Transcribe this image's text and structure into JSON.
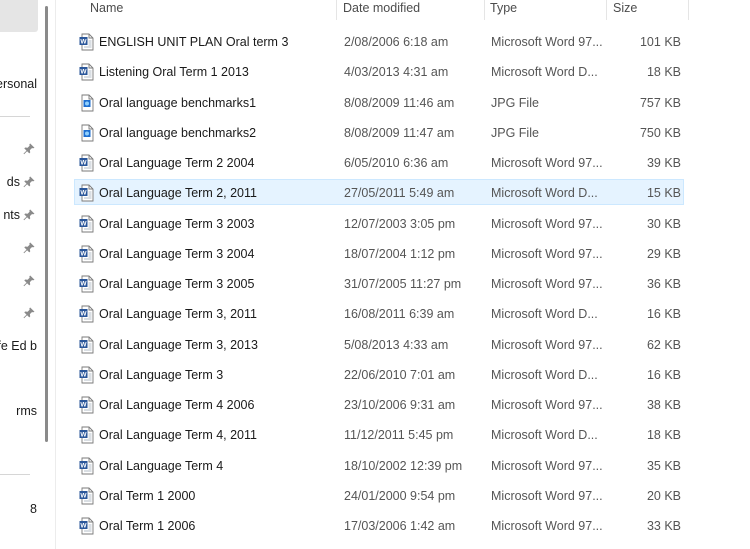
{
  "nav": {
    "items": [
      {
        "label": "ersonal",
        "pinned": false
      },
      {
        "label": "",
        "pinned": true
      },
      {
        "label": "ds",
        "pinned": true
      },
      {
        "label": "nts",
        "pinned": true
      },
      {
        "label": "",
        "pinned": true
      },
      {
        "label": "",
        "pinned": true
      },
      {
        "label": "",
        "pinned": true
      },
      {
        "label": "ife Ed b",
        "pinned": false
      },
      {
        "label": "rms",
        "pinned": false
      },
      {
        "label": "8",
        "pinned": false
      }
    ]
  },
  "columns": {
    "name": "Name",
    "date": "Date modified",
    "type": "Type",
    "size": "Size"
  },
  "files": [
    {
      "name": "ENGLISH UNIT PLAN Oral term 3",
      "date": "2/08/2006 6:18 am",
      "type": "Microsoft Word 97...",
      "size": "101 KB",
      "icon": "word-doc-icon",
      "selected": false
    },
    {
      "name": "Listening Oral Term 1 2013",
      "date": "4/03/2013 4:31 am",
      "type": "Microsoft Word D...",
      "size": "18 KB",
      "icon": "word-doc-icon",
      "selected": false
    },
    {
      "name": "Oral language benchmarks1",
      "date": "8/08/2009 11:46 am",
      "type": "JPG File",
      "size": "757 KB",
      "icon": "jpg-file-icon",
      "selected": false
    },
    {
      "name": "Oral language benchmarks2",
      "date": "8/08/2009 11:47 am",
      "type": "JPG File",
      "size": "750 KB",
      "icon": "jpg-file-icon",
      "selected": false
    },
    {
      "name": "Oral Language Term 2 2004",
      "date": "6/05/2010 6:36 am",
      "type": "Microsoft Word 97...",
      "size": "39 KB",
      "icon": "word-doc-icon",
      "selected": false
    },
    {
      "name": "Oral Language Term 2, 2011",
      "date": "27/05/2011 5:49 am",
      "type": "Microsoft Word D...",
      "size": "15 KB",
      "icon": "word-doc-icon",
      "selected": true
    },
    {
      "name": "Oral Language Term 3 2003",
      "date": "12/07/2003 3:05 pm",
      "type": "Microsoft Word 97...",
      "size": "30 KB",
      "icon": "word-doc-icon",
      "selected": false
    },
    {
      "name": "Oral Language Term 3 2004",
      "date": "18/07/2004 1:12 pm",
      "type": "Microsoft Word 97...",
      "size": "29 KB",
      "icon": "word-doc-icon",
      "selected": false
    },
    {
      "name": "Oral Language Term 3 2005",
      "date": "31/07/2005 11:27 pm",
      "type": "Microsoft Word 97...",
      "size": "36 KB",
      "icon": "word-doc-icon",
      "selected": false
    },
    {
      "name": "Oral Language Term 3, 2011",
      "date": "16/08/2011 6:39 am",
      "type": "Microsoft Word D...",
      "size": "16 KB",
      "icon": "word-doc-icon",
      "selected": false
    },
    {
      "name": "Oral Language Term 3, 2013",
      "date": "5/08/2013 4:33 am",
      "type": "Microsoft Word 97...",
      "size": "62 KB",
      "icon": "word-doc-icon",
      "selected": false
    },
    {
      "name": "Oral Language Term 3",
      "date": "22/06/2010 7:01 am",
      "type": "Microsoft Word D...",
      "size": "16 KB",
      "icon": "word-doc-icon",
      "selected": false
    },
    {
      "name": "Oral Language Term 4 2006",
      "date": "23/10/2006 9:31 am",
      "type": "Microsoft Word 97...",
      "size": "38 KB",
      "icon": "word-doc-icon",
      "selected": false
    },
    {
      "name": "Oral Language Term 4, 2011",
      "date": "11/12/2011 5:45 pm",
      "type": "Microsoft Word D...",
      "size": "18 KB",
      "icon": "word-doc-icon",
      "selected": false
    },
    {
      "name": "Oral Language Term 4",
      "date": "18/10/2002 12:39 pm",
      "type": "Microsoft Word 97...",
      "size": "35 KB",
      "icon": "word-doc-icon",
      "selected": false
    },
    {
      "name": "Oral Term 1 2000",
      "date": "24/01/2000 9:54 pm",
      "type": "Microsoft Word 97...",
      "size": "20 KB",
      "icon": "word-doc-icon",
      "selected": false
    },
    {
      "name": "Oral Term 1 2006",
      "date": "17/03/2006 1:42 am",
      "type": "Microsoft Word 97...",
      "size": "33 KB",
      "icon": "word-doc-icon",
      "selected": false
    }
  ],
  "colors": {
    "selection_bg": "#e5f3ff",
    "selection_border": "#cce8ff",
    "word_blue": "#2b579a"
  }
}
